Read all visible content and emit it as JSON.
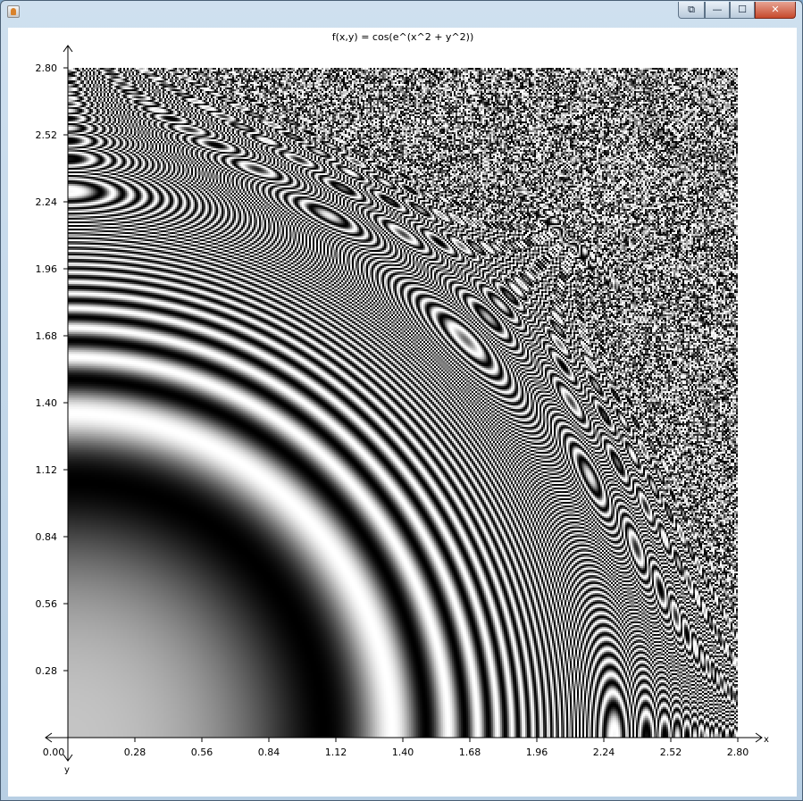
{
  "window": {
    "title": "",
    "buttons": {
      "restore": "⧉",
      "minimize": "—",
      "maximize": "☐",
      "close": "✕"
    }
  },
  "chart_data": {
    "type": "heatmap",
    "title": "f(x,y) = cos(e^(x^2 + y^2))",
    "function": "cos(exp(x^2 + y^2))",
    "xlabel": "x",
    "ylabel": "y",
    "xlim": [
      0,
      2.8
    ],
    "ylim": [
      0,
      2.8
    ],
    "x_ticks": [
      "0.00",
      "0.28",
      "0.56",
      "0.84",
      "1.12",
      "1.40",
      "1.68",
      "1.96",
      "2.24",
      "2.52",
      "2.80"
    ],
    "y_ticks": [
      "0.28",
      "0.56",
      "0.84",
      "1.12",
      "1.40",
      "1.68",
      "1.96",
      "2.24",
      "2.52",
      "2.80"
    ],
    "colormap": "grayscale",
    "colors": {
      "low": "#000000",
      "high": "#ffffff",
      "axis": "#000000"
    }
  }
}
